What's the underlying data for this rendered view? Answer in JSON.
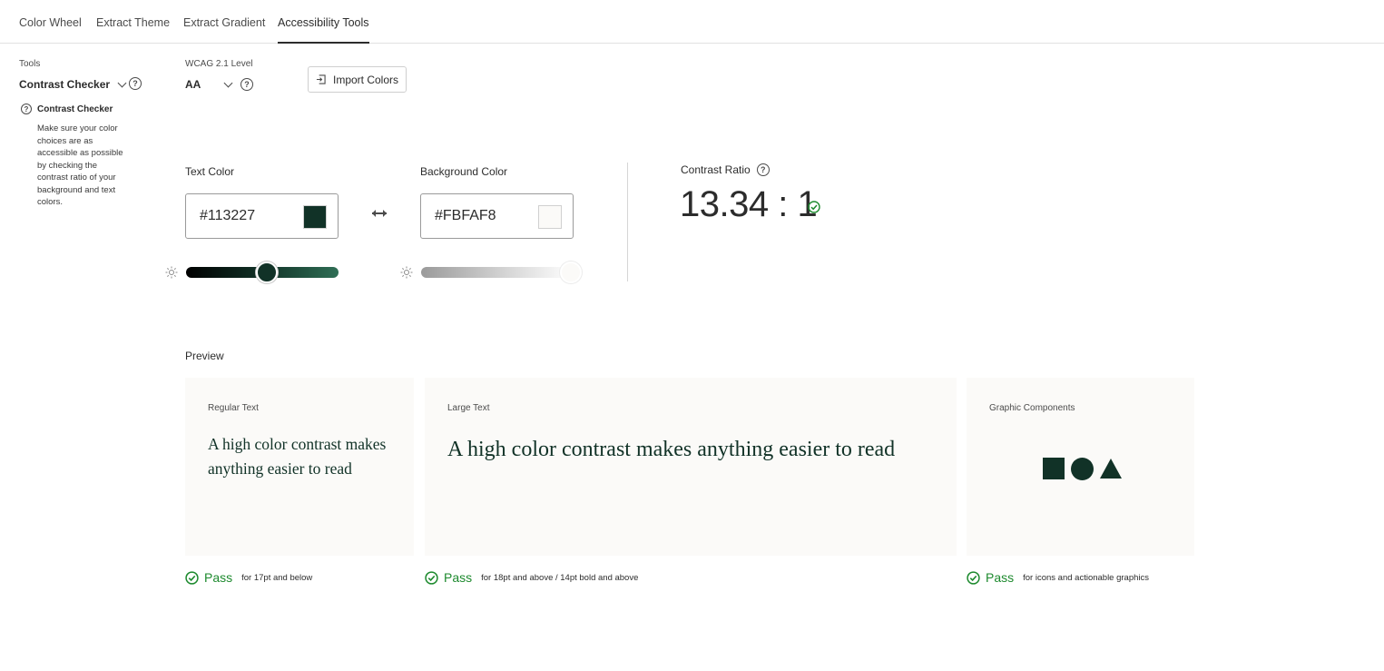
{
  "tabs": [
    {
      "label": "Color Wheel"
    },
    {
      "label": "Extract Theme"
    },
    {
      "label": "Extract Gradient"
    },
    {
      "label": "Accessibility Tools"
    }
  ],
  "sidebar": {
    "tools_label": "Tools",
    "tool_selected": "Contrast Checker",
    "info_title": "Contrast Checker",
    "info_body": "Make sure your color choices are as accessible as possible by checking the contrast ratio of your background and text colors."
  },
  "wcag": {
    "label": "WCAG 2.1 Level",
    "value": "AA"
  },
  "import_button": "Import Colors",
  "text_color": {
    "label": "Text Color",
    "value": "#113227",
    "swatch": "#113227",
    "brightness": 0.53
  },
  "background_color": {
    "label": "Background Color",
    "value": "#FBFAF8",
    "swatch": "#FBFAF8",
    "brightness": 0.98
  },
  "contrast": {
    "label": "Contrast Ratio",
    "value": "13.34 : 1"
  },
  "preview": {
    "label": "Preview",
    "cards": [
      {
        "title": "Regular Text",
        "text": "A high color contrast makes anything easier to read"
      },
      {
        "title": "Large Text",
        "text": "A high color contrast makes anything easier to read"
      },
      {
        "title": "Graphic Components"
      }
    ],
    "results": [
      {
        "status": "Pass",
        "note": "for 17pt and below"
      },
      {
        "status": "Pass",
        "note": "for 18pt and above / 14pt bold and above"
      },
      {
        "status": "Pass",
        "note": "for icons and actionable graphics"
      }
    ]
  },
  "colors": {
    "pass_green": "#1d8a2e",
    "accent_dark": "#113227"
  }
}
